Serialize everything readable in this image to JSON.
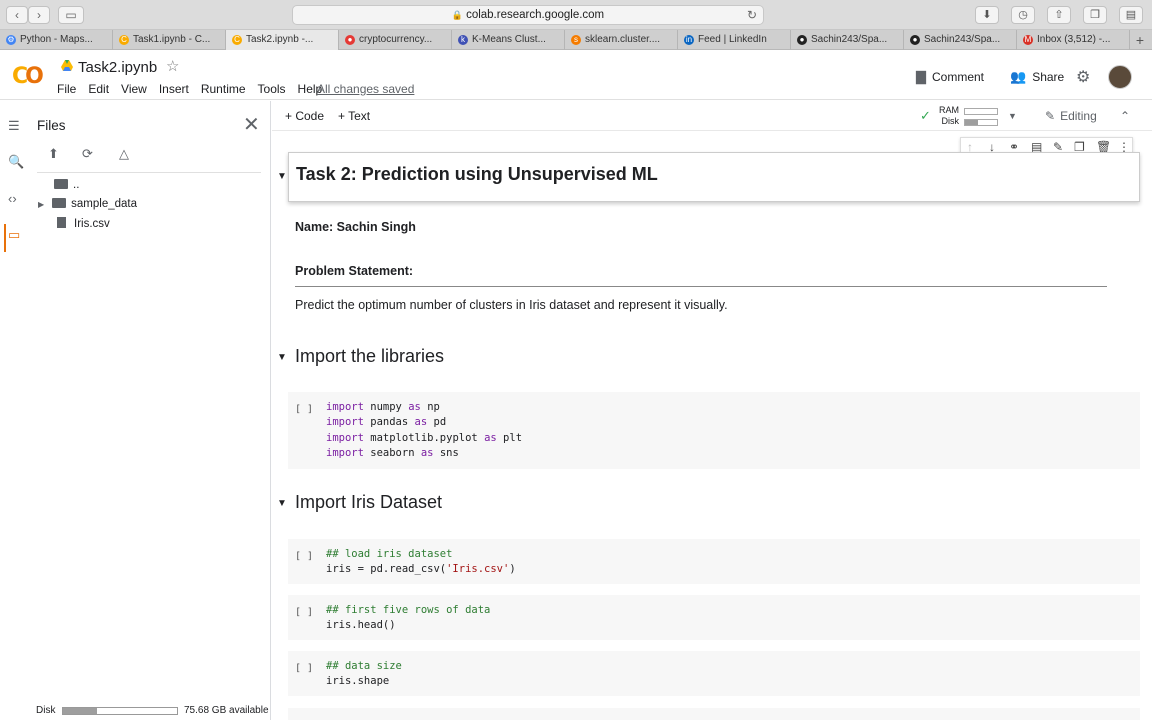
{
  "browser": {
    "url": "colab.research.google.com",
    "tabs": [
      {
        "label": "Python - Maps...",
        "color": "#4285f4",
        "glyph": "⚙"
      },
      {
        "label": "Task1.ipynb - C...",
        "color": "#f9ab00",
        "glyph": "C"
      },
      {
        "label": "Task2.ipynb -...",
        "color": "#f9ab00",
        "glyph": "C"
      },
      {
        "label": "cryptocurrency...",
        "color": "#e53935",
        "glyph": "●"
      },
      {
        "label": "K-Means Clust...",
        "color": "#3f51b5",
        "glyph": "k"
      },
      {
        "label": "sklearn.cluster....",
        "color": "#f57c00",
        "glyph": "s"
      },
      {
        "label": "Feed | LinkedIn",
        "color": "#0a66c2",
        "glyph": "in"
      },
      {
        "label": "Sachin243/Spa...",
        "color": "#222222",
        "glyph": "●"
      },
      {
        "label": "Sachin243/Spa...",
        "color": "#222222",
        "glyph": "●"
      },
      {
        "label": "Inbox (3,512) -...",
        "color": "#d93025",
        "glyph": "M"
      }
    ]
  },
  "header": {
    "title": "Task2.ipynb",
    "menu": [
      "File",
      "Edit",
      "View",
      "Insert",
      "Runtime",
      "Tools",
      "Help"
    ],
    "saved": "All changes saved",
    "comment": "Comment",
    "share": "Share"
  },
  "files": {
    "title": "Files",
    "tree": [
      {
        "label": "..",
        "kind": "up"
      },
      {
        "label": "sample_data",
        "kind": "folder"
      },
      {
        "label": "Iris.csv",
        "kind": "file"
      }
    ],
    "disk_label": "Disk",
    "disk_avail": "75.68 GB available",
    "disk_used_pct": 30
  },
  "toolbar": {
    "code": "Code",
    "text": "Text",
    "ram": "RAM",
    "disk": "Disk",
    "editing": "Editing"
  },
  "notebook": {
    "heading": "Task 2: Prediction using Unsupervised ML",
    "name": "Name: Sachin Singh",
    "problem_label": "Problem Statement:",
    "problem_text": "Predict the optimum number of clusters in Iris dataset and represent it visually.",
    "section1": "Import the libraries",
    "section2": "Import Iris Dataset",
    "cell_bracket": "[ ]",
    "code1": {
      "kw_import": "import",
      "kw_as": "as",
      "l1_mod": "numpy",
      "l1_alias": "np",
      "l2_mod": "pandas",
      "l2_alias": "pd",
      "l3_mod": "matplotlib.pyplot",
      "l3_alias": "plt",
      "l4_mod": "seaborn",
      "l4_alias": "sns"
    },
    "code2": {
      "comment": "## load iris dataset",
      "pre": "iris = pd.read_csv(",
      "str": "'Iris.csv'",
      "post": ")"
    },
    "code3": {
      "comment": "## first five rows of data",
      "line": "iris.head()"
    },
    "code4": {
      "comment": "## data size",
      "line": "iris.shape"
    }
  }
}
